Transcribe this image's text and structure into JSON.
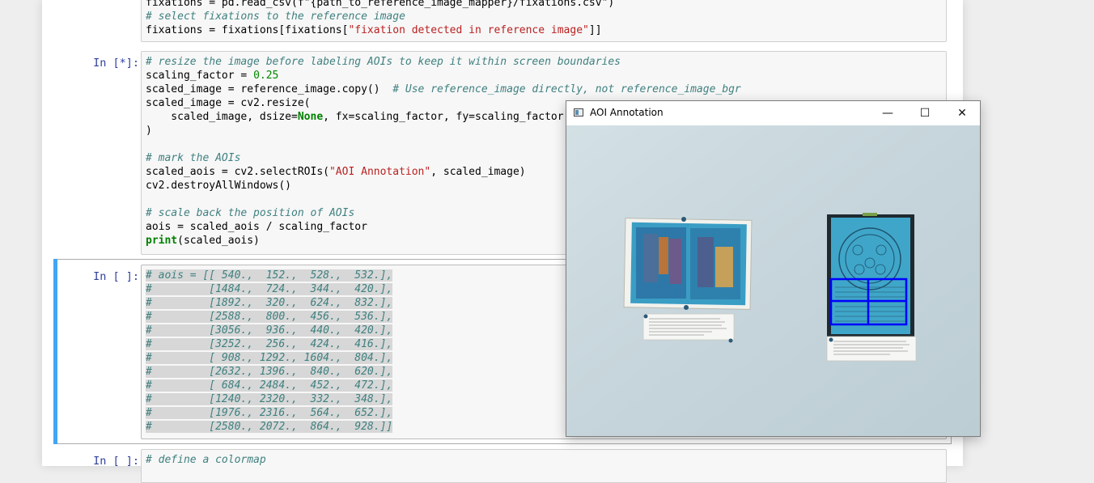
{
  "cells": [
    {
      "prompt": "",
      "lines": [
        [
          {
            "t": "fixations = pd.read_csv(f\"{path_to_reference_image_mapper}/fixations.csv\")",
            "c": ""
          }
        ],
        [
          {
            "t": "# select fixations to the reference image",
            "c": "cm-comment"
          }
        ],
        [
          {
            "t": "fixations = fixations[fixations[",
            "c": ""
          },
          {
            "t": "\"fixation detected in reference image\"",
            "c": "cm-string"
          },
          {
            "t": "]]",
            "c": ""
          }
        ]
      ]
    },
    {
      "prompt": "In [*]:",
      "lines": [
        [
          {
            "t": "# resize the image before labeling AOIs to keep it within screen boundaries",
            "c": "cm-comment"
          }
        ],
        [
          {
            "t": "scaling_factor = ",
            "c": ""
          },
          {
            "t": "0.25",
            "c": "cm-number"
          }
        ],
        [
          {
            "t": "scaled_image = reference_image.copy()  ",
            "c": ""
          },
          {
            "t": "# Use reference_image directly, not reference_image_bgr",
            "c": "cm-comment"
          }
        ],
        [
          {
            "t": "scaled_image = cv2.resize(",
            "c": ""
          }
        ],
        [
          {
            "t": "    scaled_image, dsize=",
            "c": ""
          },
          {
            "t": "None",
            "c": "cm-keyword"
          },
          {
            "t": ", fx=scaling_factor, fy=scaling_factor",
            "c": ""
          }
        ],
        [
          {
            "t": ")",
            "c": ""
          }
        ],
        [
          {
            "t": "",
            "c": ""
          }
        ],
        [
          {
            "t": "# mark the AOIs",
            "c": "cm-comment"
          }
        ],
        [
          {
            "t": "scaled_aois = cv2.selectROIs(",
            "c": ""
          },
          {
            "t": "\"AOI Annotation\"",
            "c": "cm-string"
          },
          {
            "t": ", scaled_image)",
            "c": ""
          }
        ],
        [
          {
            "t": "cv2.destroyAllWindows()",
            "c": ""
          }
        ],
        [
          {
            "t": "",
            "c": ""
          }
        ],
        [
          {
            "t": "# scale back the position of AOIs",
            "c": "cm-comment"
          }
        ],
        [
          {
            "t": "aois = scaled_aois / scaling_factor",
            "c": ""
          }
        ],
        [
          {
            "t": "print",
            "c": "cm-keyword"
          },
          {
            "t": "(scaled_aois)",
            "c": ""
          }
        ]
      ]
    },
    {
      "prompt": "In [ ]:",
      "lines": [
        [
          {
            "t": "# aois = [[ 540.,  152.,  528.,  532.],",
            "c": "cm-comment"
          }
        ],
        [
          {
            "t": "#         [1484.,  724.,  344.,  420.],",
            "c": "cm-comment"
          }
        ],
        [
          {
            "t": "#         [1892.,  320.,  624.,  832.],",
            "c": "cm-comment"
          }
        ],
        [
          {
            "t": "#         [2588.,  800.,  456.,  536.],",
            "c": "cm-comment"
          }
        ],
        [
          {
            "t": "#         [3056.,  936.,  440.,  420.],",
            "c": "cm-comment"
          }
        ],
        [
          {
            "t": "#         [3252.,  256.,  424.,  416.],",
            "c": "cm-comment"
          }
        ],
        [
          {
            "t": "#         [ 908., 1292., 1604.,  804.],",
            "c": "cm-comment"
          }
        ],
        [
          {
            "t": "#         [2632., 1396.,  840.,  620.],",
            "c": "cm-comment"
          }
        ],
        [
          {
            "t": "#         [ 684., 2484.,  452.,  472.],",
            "c": "cm-comment"
          }
        ],
        [
          {
            "t": "#         [1240., 2320.,  332.,  348.],",
            "c": "cm-comment"
          }
        ],
        [
          {
            "t": "#         [1976., 2316.,  564.,  652.],",
            "c": "cm-comment"
          }
        ],
        [
          {
            "t": "#         [2580., 2072.,  864.,  928.]]",
            "c": "cm-comment"
          }
        ]
      ]
    },
    {
      "prompt": "In [ ]:",
      "lines": [
        [
          {
            "t": "# define a colormap",
            "c": "cm-comment"
          }
        ]
      ]
    }
  ],
  "window": {
    "title": "AOI Annotation",
    "minimize_glyph": "—",
    "maximize_glyph": "☐",
    "close_glyph": "✕",
    "roi_color": "#0000ff"
  }
}
